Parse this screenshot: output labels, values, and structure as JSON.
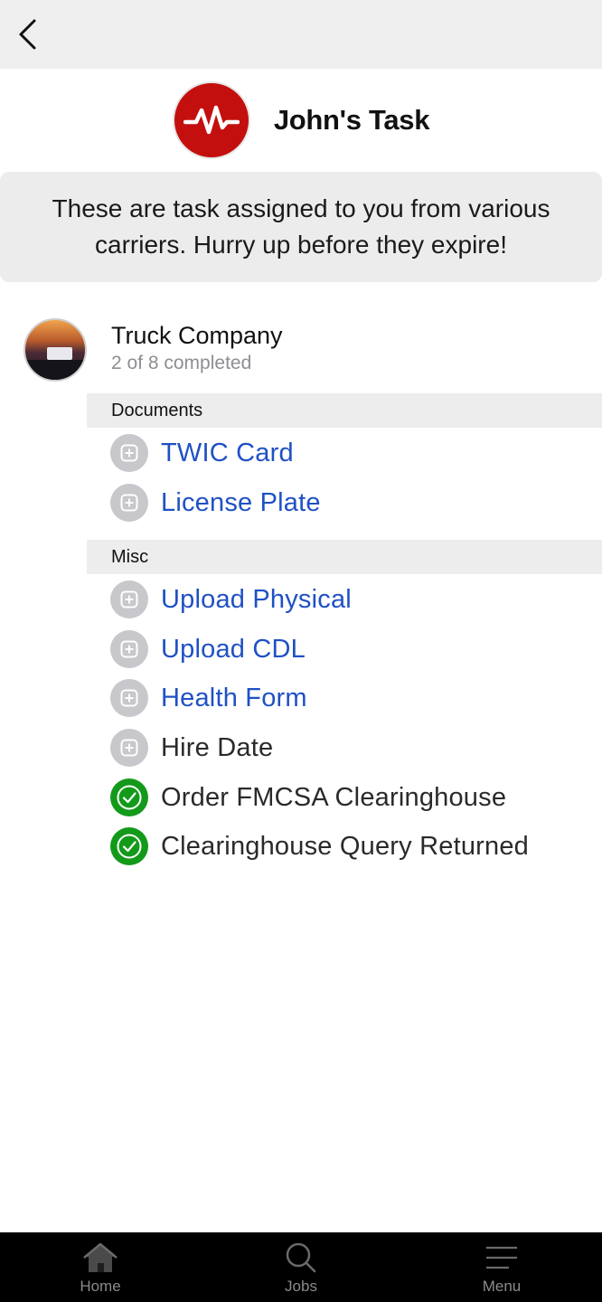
{
  "nav": {
    "back_icon": "chevron-left-icon"
  },
  "header": {
    "title": "John's Task",
    "logo_icon": "heartbeat-pulse-icon",
    "logo_color": "#c40f0f"
  },
  "banner": {
    "text": "These are task assigned to you from various carriers. Hurry up before they expire!"
  },
  "company": {
    "name": "Truck Company",
    "progress": "2 of 8 completed"
  },
  "sections": [
    {
      "title": "Documents",
      "tasks": [
        {
          "label": "TWIC Card",
          "status": "pending",
          "link": true
        },
        {
          "label": "License Plate",
          "status": "pending",
          "link": true
        }
      ]
    },
    {
      "title": "Misc",
      "tasks": [
        {
          "label": "Upload Physical",
          "status": "pending",
          "link": true
        },
        {
          "label": "Upload CDL",
          "status": "pending",
          "link": true
        },
        {
          "label": "Health Form",
          "status": "pending",
          "link": true
        },
        {
          "label": "Hire Date",
          "status": "pending",
          "link": false
        },
        {
          "label": "Order FMCSA Clearinghouse",
          "status": "done",
          "link": false
        },
        {
          "label": "Clearinghouse Query Returned",
          "status": "done",
          "link": false
        }
      ]
    }
  ],
  "tabbar": {
    "items": [
      {
        "label": "Home",
        "icon": "home-icon"
      },
      {
        "label": "Jobs",
        "icon": "search-icon"
      },
      {
        "label": "Menu",
        "icon": "menu-icon"
      }
    ]
  },
  "colors": {
    "link": "#1f51c4",
    "done": "#139a1a",
    "pending": "#c7c7cc"
  }
}
